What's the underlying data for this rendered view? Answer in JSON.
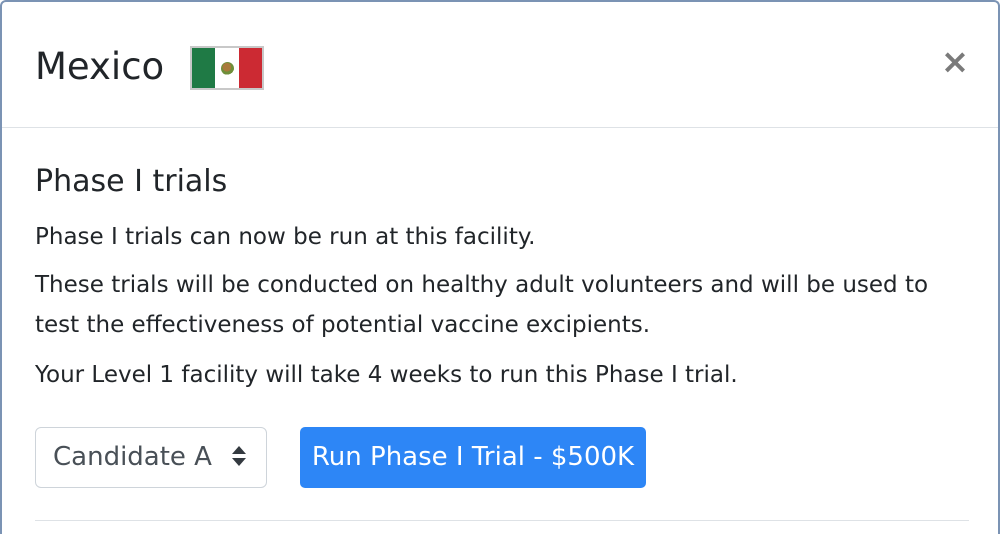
{
  "header": {
    "title": "Mexico",
    "flag_icon": "mexico-flag",
    "close_label": "×"
  },
  "body": {
    "section_title": "Phase I trials",
    "paragraphs": [
      "Phase I trials can now be run at this facility.",
      "These trials will be conducted on healthy adult volunteers and will be used to test the effectiveness of potential vaccine excipients.",
      "Your Level 1 facility will take 4 weeks to run this Phase I trial."
    ],
    "candidate_select": {
      "selected": "Candidate A"
    },
    "run_button_label": "Run Phase I Trial - $500K"
  },
  "colors": {
    "primary_button": "#2d86f6",
    "modal_border": "#7b93b4",
    "flag_green": "#1f7a45",
    "flag_red": "#cc2a33"
  }
}
